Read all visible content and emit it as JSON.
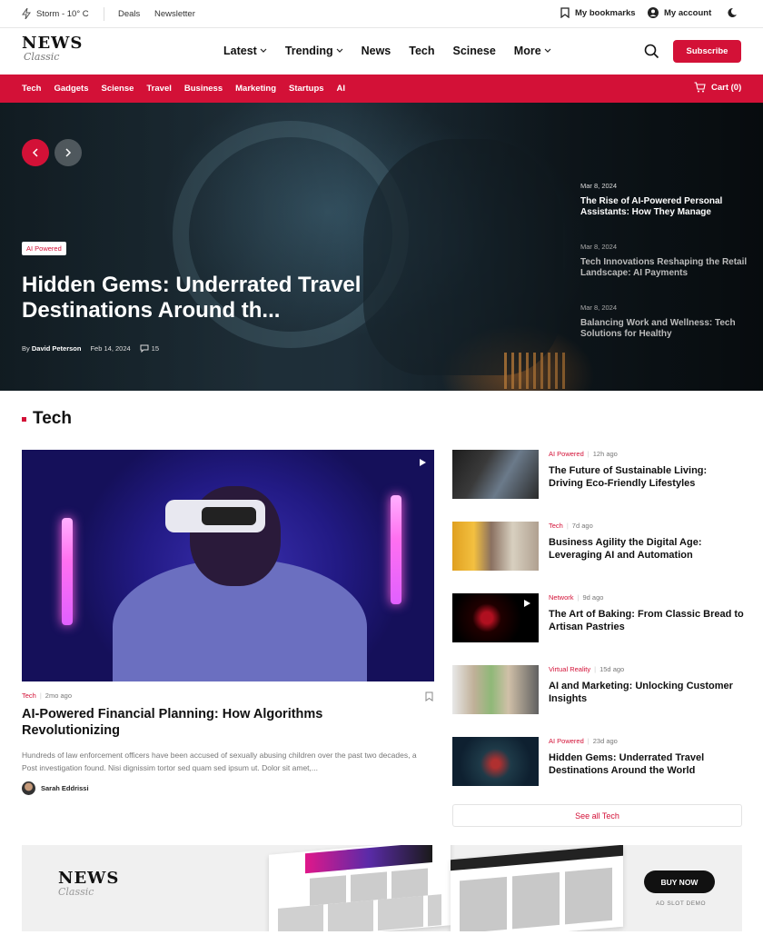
{
  "topbar": {
    "weather": "Storm - 10° C",
    "links": [
      "Deals",
      "Newsletter"
    ],
    "bookmarks": "My bookmarks",
    "account": "My account"
  },
  "header": {
    "logo_top": "NEWS",
    "logo_bottom": "Classic",
    "nav": [
      "Latest",
      "Trending",
      "News",
      "Tech",
      "Scinese",
      "More"
    ],
    "subscribe": "Subscribe"
  },
  "catbar": {
    "items": [
      "Tech",
      "Gadgets",
      "Sciense",
      "Travel",
      "Business",
      "Marketing",
      "Startups",
      "AI"
    ],
    "cart": "Cart (0)"
  },
  "hero": {
    "tag": "AI Powered",
    "title": "Hidden Gems: Underrated Travel Destinations Around th...",
    "by": "By",
    "author": "David Peterson",
    "date": "Feb 14, 2024",
    "comments": "15",
    "side": [
      {
        "date": "Mar 8, 2024",
        "title": "The Rise of AI-Powered Personal Assistants: How They Manage"
      },
      {
        "date": "Mar 8, 2024",
        "title": "Tech Innovations Reshaping the Retail Landscape: AI Payments"
      },
      {
        "date": "Mar 8, 2024",
        "title": "Balancing Work and Wellness: Tech Solutions for Healthy"
      }
    ]
  },
  "section": {
    "title": "Tech"
  },
  "feature": {
    "category": "Tech",
    "time": "2mo ago",
    "title": "AI-Powered Financial Planning: How Algorithms Revolutionizing",
    "excerpt": "Hundreds of law enforcement officers have been accused of sexually abusing children over the past two decades, a Post investigation found. Nisi dignissim tortor sed quam sed ipsum ut. Dolor sit amet,...",
    "author": "Sarah Eddrissi"
  },
  "list": [
    {
      "category": "AI Powered",
      "time": "12h ago",
      "title": "The Future of Sustainable Living: Driving Eco-Friendly Lifestyles"
    },
    {
      "category": "Tech",
      "time": "7d ago",
      "title": "Business Agility the Digital Age: Leveraging AI and Automation"
    },
    {
      "category": "Network",
      "time": "9d ago",
      "title": "The Art of Baking: From Classic Bread to Artisan Pastries"
    },
    {
      "category": "Virtual Reality",
      "time": "15d ago",
      "title": "AI and Marketing: Unlocking Customer Insights"
    },
    {
      "category": "AI Powered",
      "time": "23d ago",
      "title": "Hidden Gems: Underrated Travel Destinations Around the World"
    }
  ],
  "see_all": "See all Tech",
  "ad": {
    "logo_top": "NEWS",
    "logo_bottom": "Classic",
    "buy": "BUY NOW",
    "slot": "AD SLOT DEMO"
  },
  "colors": {
    "accent": "#d31137",
    "dark": "#111111"
  },
  "icons": [
    "lightning-icon",
    "bookmark-icon",
    "user-icon",
    "moon-icon",
    "search-icon",
    "cart-icon",
    "chevron-left-icon",
    "chevron-right-icon",
    "comment-icon",
    "play-icon",
    "chevron-down-icon"
  ]
}
